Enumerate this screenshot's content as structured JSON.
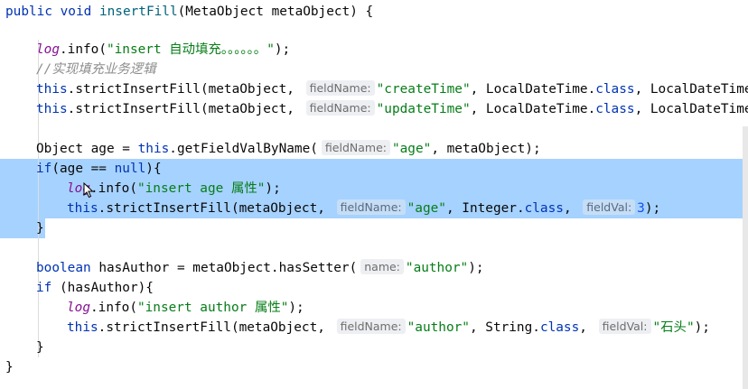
{
  "editor": {
    "line1": {
      "p1": "public void ",
      "p2": "insertFill",
      "p3": "(MetaObject metaObject) {"
    },
    "line2": {
      "fld": "log",
      "p1": ".info(",
      "str": "\"insert 自动填充。。。。。。\"",
      "p2": ");"
    },
    "line3": {
      "comment": "//实现填充业务逻辑"
    },
    "line4": {
      "kw": "this",
      "p1": ".strictInsertFill(metaObject, ",
      "hint": "fieldName:",
      "str": "\"createTime\"",
      "p2": ", LocalDateTime.",
      "kw2": "class",
      "p3": ", LocalDateTime.",
      "p4": "n"
    },
    "line5": {
      "kw": "this",
      "p1": ".strictInsertFill(metaObject, ",
      "hint": "fieldName:",
      "str": "\"updateTime\"",
      "p2": ", LocalDateTime.",
      "kw2": "class",
      "p3": ", LocalDateTime.",
      "p4": "n"
    },
    "line6": {
      "p1": "Object age = ",
      "kw": "this",
      "p2": ".getFieldValByName(",
      "hint": "fieldName:",
      "str": "\"age\"",
      "p3": ", metaObject);"
    },
    "line7": {
      "p1": "if",
      "p2": "(age == ",
      "kw": "null",
      "p3": "){"
    },
    "line8": {
      "fld": "log",
      "p1": ".info(",
      "str": "\"insert age 属性\"",
      "p2": ");"
    },
    "line9": {
      "kw": "this",
      "p1": ".strictInsertFill(metaObject, ",
      "hint": "fieldName:",
      "str": "\"age\"",
      "p2": ", Integer.",
      "kw2": "class",
      "p3": ", ",
      "hint2": "fieldVal:",
      "num": "3",
      "p4": ");"
    },
    "line10": {
      "p1": "}"
    },
    "line11": {
      "kw": "boolean",
      "p1": " hasAuthor = metaObject.hasSetter(",
      "hint": "name:",
      "str": "\"author\"",
      "p2": ");"
    },
    "line12": {
      "kw": "if",
      "p1": " (hasAuthor){"
    },
    "line13": {
      "fld": "log",
      "p1": ".info(",
      "str": "\"insert author 属性\"",
      "p2": ");"
    },
    "line14": {
      "kw": "this",
      "p1": ".strictInsertFill(metaObject, ",
      "hint": "fieldName:",
      "str": "\"author\"",
      "p2": ", String.",
      "kw2": "class",
      "p3": ", ",
      "hint2": "fieldVal:",
      "str2": "\"石头\"",
      "p4": ");"
    },
    "line15": {
      "p1": "}"
    },
    "line16": {
      "p1": "}"
    }
  },
  "colors": {
    "keyword": "#0033b3",
    "string": "#067d17",
    "number": "#1750eb",
    "field": "#871094",
    "comment": "#8c8c8c",
    "selection": "#a6d2ff"
  },
  "icons": {
    "cursor": "mouse-pointer-icon"
  }
}
